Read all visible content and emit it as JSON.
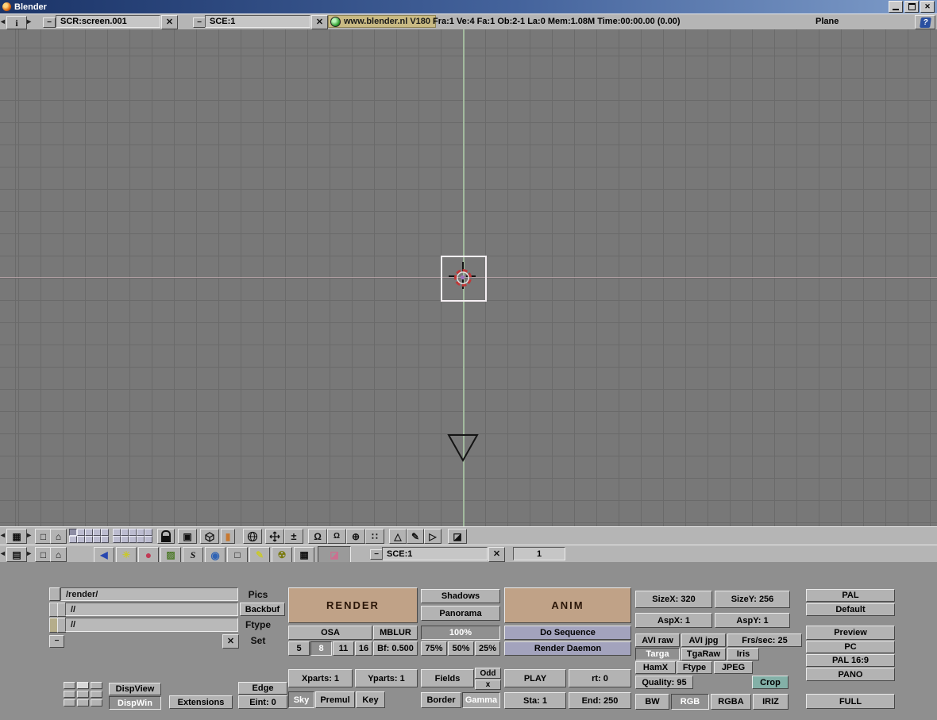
{
  "window": {
    "title": "Blender"
  },
  "info_header": {
    "screen_value": "SCR:screen.001",
    "scene_value": "SCE:1",
    "version": "www.blender.nl V180",
    "stats": "Fra:1   Ve:4 Fa:1   Ob:2-1 La:0   Mem:1.08M Time:00:00.00 (0.00)",
    "active_object": "Plane"
  },
  "buttons_header": {
    "scene_value": "SCE:1",
    "frame_value": "1"
  },
  "output": {
    "pics_path": "/render/",
    "pics_label": "Pics",
    "backbuf_path": "//",
    "backbuf_label": "Backbuf",
    "ftype_path": "//",
    "ftype_label": "Ftype",
    "set_label": "Set"
  },
  "render": {
    "render": "RENDER",
    "shadows": "Shadows",
    "panorama": "Panorama",
    "osa": "OSA",
    "mblur": "MBLUR",
    "pct100": "100%",
    "osa5": "5",
    "osa8": "8",
    "osa11": "11",
    "osa16": "16",
    "bf": "Bf: 0.500",
    "pct75": "75%",
    "pct50": "50%",
    "pct25": "25%",
    "xparts": "Xparts: 1",
    "yparts": "Yparts: 1",
    "fields": "Fields",
    "odd": "Odd",
    "odd_x": "x",
    "sky": "Sky",
    "premul": "Premul",
    "key": "Key",
    "border": "Border",
    "gamma": "Gamma"
  },
  "anim": {
    "anim": "ANIM",
    "do_sequence": "Do Sequence",
    "render_daemon": "Render Daemon",
    "play": "PLAY",
    "rt": "rt: 0",
    "sta": "Sta: 1",
    "end": "End: 250"
  },
  "format": {
    "sizex": "SizeX: 320",
    "sizey": "SizeY: 256",
    "aspx": "AspX: 1",
    "aspy": "AspY: 1",
    "avi_raw": "AVI raw",
    "avi_jpg": "AVI jpg",
    "frs_sec": "Frs/sec: 25",
    "targa": "Targa",
    "tgaraw": "TgaRaw",
    "iris": "Iris",
    "hamx": "HamX",
    "ftype": "Ftype",
    "jpeg": "JPEG",
    "quality": "Quality: 95",
    "crop": "Crop",
    "bw": "BW",
    "rgb": "RGB",
    "rgba": "RGBA",
    "iriz": "IRIZ"
  },
  "presets": {
    "pal": "PAL",
    "default": "Default",
    "preview": "Preview",
    "pc": "PC",
    "pal169": "PAL 16:9",
    "pano": "PANO",
    "full": "FULL"
  },
  "display": {
    "dispview": "DispView",
    "dispwin": "DispWin",
    "extensions": "Extensions",
    "edge": "Edge",
    "eint": "Eint: 0"
  },
  "icons": {
    "info_window": "i",
    "grid": "▦",
    "bars": "▤",
    "fullscreen": "□",
    "home": "⌂",
    "local_view": "▣",
    "orange_box": "▮",
    "plusminus": "±",
    "rotate": "Ω",
    "center": "⊕",
    "dots": "∷",
    "triangle": "△",
    "pencil": "✎",
    "triangle2": "▷",
    "image": "◪",
    "lamp": "◀",
    "sun": "☀",
    "material": "●",
    "texture": "▨",
    "ipo": "S",
    "world": "◉",
    "edit": "□",
    "radio": "☢",
    "script": "▦",
    "close": "✕",
    "menu": "−",
    "help": "?",
    "arrow_left": "◂",
    "arrow_right": "▸"
  },
  "colors": {
    "titlebar_left": "#1b3468",
    "titlebar_right": "#7e9cc9",
    "header_gray": "#b5b5b5",
    "viewport_gray": "#787878",
    "panel_gray": "#8f8f8f",
    "button_gray": "#b3b3b3",
    "render_tan": "#c0a287",
    "sequence_purple": "#a3a3bd",
    "crop_teal": "#83b0a7",
    "version_chip": "#c9ba83",
    "axis_green": "#a9c3a4",
    "axis_pink": "#bda7ad"
  }
}
